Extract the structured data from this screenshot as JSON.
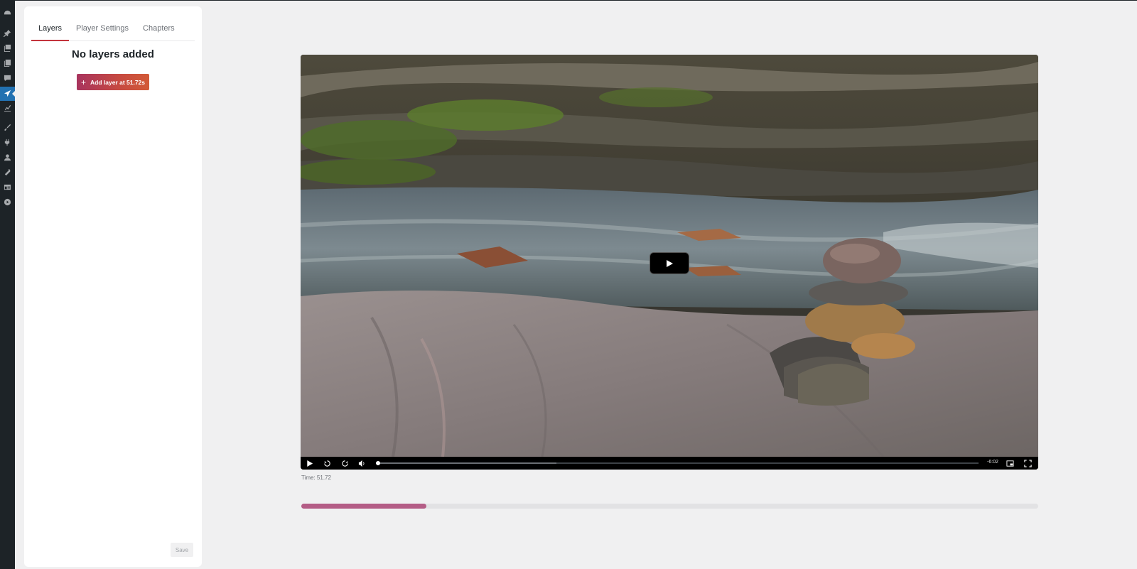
{
  "tabs": [
    {
      "label": "Layers",
      "active": true
    },
    {
      "label": "Player Settings",
      "active": false
    },
    {
      "label": "Chapters",
      "active": false
    }
  ],
  "panel": {
    "title": "No layers added",
    "add_button_label": "Add layer at 51.72s",
    "save_label": "Save"
  },
  "player": {
    "remaining": "-6:02",
    "time_label": "Time: 51.72",
    "played_fraction": 0.17,
    "buffered_fraction": 0.3
  },
  "colors": {
    "accent": "#c3343c",
    "timeline_fill": "#b45d86",
    "rail_bg": "#1d2327",
    "rail_active": "#2271b1"
  },
  "rail_icons": [
    "dashboard-icon",
    "pin-icon",
    "media-icon",
    "pages-icon",
    "comments-icon",
    "send-icon",
    "chart-icon",
    "brush-icon",
    "plugins-icon",
    "users-icon",
    "tools-icon",
    "settings-icon",
    "play-circle-icon"
  ]
}
